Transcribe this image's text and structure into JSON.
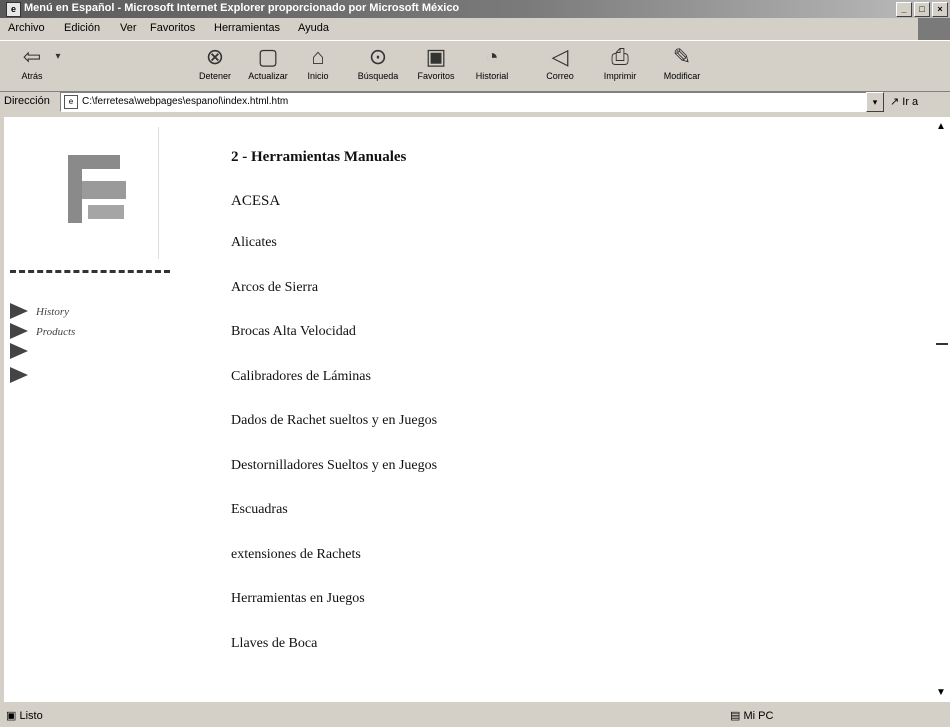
{
  "window": {
    "title": "Menú en Español - Microsoft Internet Explorer proporcionado por Microsoft México"
  },
  "menu": [
    "Archivo",
    "Edición",
    "Ver",
    "Favoritos",
    "Herramientas",
    "Ayuda"
  ],
  "toolbar": {
    "back": "Atrás",
    "stop": "Detener",
    "refresh": "Actualizar",
    "home": "Inicio",
    "search": "Búsqueda",
    "favorites": "Favoritos",
    "history": "Historial",
    "mail": "Correo",
    "print": "Imprimir",
    "edit": "Modificar"
  },
  "address": {
    "label": "Dirección",
    "value": "C:\\ferretesa\\webpages\\espanol\\index.html.htm",
    "go": "Ir a"
  },
  "nav": [
    {
      "label": "History",
      "icon": "triangle-arrow-icon"
    },
    {
      "label": "Products",
      "icon": "triangle-arrow-icon"
    },
    {
      "label": "",
      "icon": "triangle-arrow-icon"
    },
    {
      "label": "",
      "icon": "triangle-arrow-icon"
    }
  ],
  "main": {
    "heading": "2 - Herramientas Manuales",
    "brand": "ACESA",
    "categories": [
      "Alicates",
      "Arcos de Sierra",
      "Brocas Alta Velocidad",
      "Calibradores de Láminas",
      "Dados de Rachet sueltos y en Juegos",
      "Destornilladores Sueltos y en Juegos",
      "Escuadras",
      "extensiones de Rachets",
      "Herramientas en Juegos",
      "Llaves de Boca"
    ]
  },
  "status": {
    "left": "Listo",
    "zone": "Mi PC"
  },
  "colors": {
    "logo": "#888888",
    "arrow": "#444444"
  }
}
